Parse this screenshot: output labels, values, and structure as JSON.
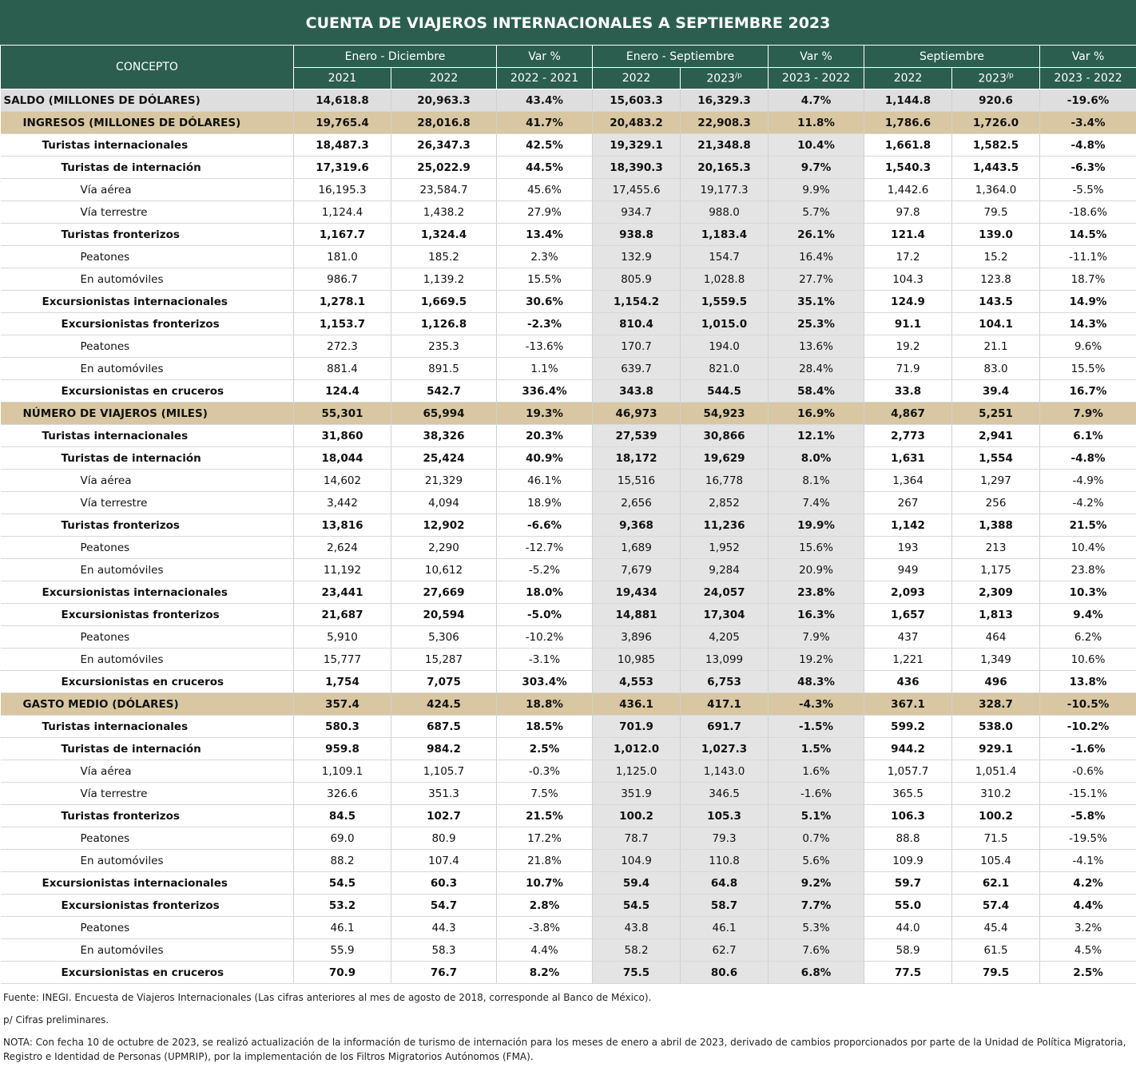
{
  "title": "CUENTA DE VIAJEROS INTERNACIONALES A SEPTIEMBRE 2023",
  "header": {
    "concepto": "CONCEPTO",
    "groups": [
      "Enero - Diciembre",
      "Var %",
      "Enero - Septiembre",
      "Var %",
      "Septiembre",
      "Var %"
    ],
    "sub": [
      "2021",
      "2022",
      "2022 - 2021",
      "2022",
      "2023",
      "2023 - 2022",
      "2022",
      "2023",
      "2023 - 2022"
    ],
    "sup_p": "/p"
  },
  "rows": [
    {
      "label": "SALDO (MILLONES DE DÓLARES)",
      "level": 0,
      "style": "saldo",
      "v": [
        "14,618.8",
        "20,963.3",
        "43.4%",
        "15,603.3",
        "16,329.3",
        "4.7%",
        "1,144.8",
        "920.6",
        "-19.6%"
      ]
    },
    {
      "label": "INGRESOS (MILLONES DE DÓLARES)",
      "level": 1,
      "style": "sec",
      "v": [
        "19,765.4",
        "28,016.8",
        "41.7%",
        "20,483.2",
        "22,908.3",
        "11.8%",
        "1,786.6",
        "1,726.0",
        "-3.4%"
      ]
    },
    {
      "label": "Turistas internacionales",
      "level": 2,
      "style": "b",
      "v": [
        "18,487.3",
        "26,347.3",
        "42.5%",
        "19,329.1",
        "21,348.8",
        "10.4%",
        "1,661.8",
        "1,582.5",
        "-4.8%"
      ]
    },
    {
      "label": "Turistas de internación",
      "level": 3,
      "style": "b",
      "v": [
        "17,319.6",
        "25,022.9",
        "44.5%",
        "18,390.3",
        "20,165.3",
        "9.7%",
        "1,540.3",
        "1,443.5",
        "-6.3%"
      ]
    },
    {
      "label": "Vía aérea",
      "level": 4,
      "style": "n",
      "v": [
        "16,195.3",
        "23,584.7",
        "45.6%",
        "17,455.6",
        "19,177.3",
        "9.9%",
        "1,442.6",
        "1,364.0",
        "-5.5%"
      ]
    },
    {
      "label": "Vía terrestre",
      "level": 4,
      "style": "n",
      "v": [
        "1,124.4",
        "1,438.2",
        "27.9%",
        "934.7",
        "988.0",
        "5.7%",
        "97.8",
        "79.5",
        "-18.6%"
      ]
    },
    {
      "label": "Turistas fronterizos",
      "level": 3,
      "style": "b",
      "v": [
        "1,167.7",
        "1,324.4",
        "13.4%",
        "938.8",
        "1,183.4",
        "26.1%",
        "121.4",
        "139.0",
        "14.5%"
      ]
    },
    {
      "label": "Peatones",
      "level": 4,
      "style": "n",
      "v": [
        "181.0",
        "185.2",
        "2.3%",
        "132.9",
        "154.7",
        "16.4%",
        "17.2",
        "15.2",
        "-11.1%"
      ]
    },
    {
      "label": "En automóviles",
      "level": 4,
      "style": "n",
      "v": [
        "986.7",
        "1,139.2",
        "15.5%",
        "805.9",
        "1,028.8",
        "27.7%",
        "104.3",
        "123.8",
        "18.7%"
      ]
    },
    {
      "label": "Excursionistas internacionales",
      "level": 2,
      "style": "b",
      "v": [
        "1,278.1",
        "1,669.5",
        "30.6%",
        "1,154.2",
        "1,559.5",
        "35.1%",
        "124.9",
        "143.5",
        "14.9%"
      ]
    },
    {
      "label": "Excursionistas fronterizos",
      "level": 3,
      "style": "b",
      "v": [
        "1,153.7",
        "1,126.8",
        "-2.3%",
        "810.4",
        "1,015.0",
        "25.3%",
        "91.1",
        "104.1",
        "14.3%"
      ]
    },
    {
      "label": "Peatones",
      "level": 4,
      "style": "n",
      "v": [
        "272.3",
        "235.3",
        "-13.6%",
        "170.7",
        "194.0",
        "13.6%",
        "19.2",
        "21.1",
        "9.6%"
      ]
    },
    {
      "label": "En automóviles",
      "level": 4,
      "style": "n",
      "v": [
        "881.4",
        "891.5",
        "1.1%",
        "639.7",
        "821.0",
        "28.4%",
        "71.9",
        "83.0",
        "15.5%"
      ]
    },
    {
      "label": "Excursionistas en cruceros",
      "level": 3,
      "style": "b",
      "v": [
        "124.4",
        "542.7",
        "336.4%",
        "343.8",
        "544.5",
        "58.4%",
        "33.8",
        "39.4",
        "16.7%"
      ]
    },
    {
      "label": "NÚMERO DE VIAJEROS (MILES)",
      "level": 1,
      "style": "sec",
      "v": [
        "55,301",
        "65,994",
        "19.3%",
        "46,973",
        "54,923",
        "16.9%",
        "4,867",
        "5,251",
        "7.9%"
      ]
    },
    {
      "label": "Turistas internacionales",
      "level": 2,
      "style": "b",
      "v": [
        "31,860",
        "38,326",
        "20.3%",
        "27,539",
        "30,866",
        "12.1%",
        "2,773",
        "2,941",
        "6.1%"
      ]
    },
    {
      "label": "Turistas de internación",
      "level": 3,
      "style": "b",
      "v": [
        "18,044",
        "25,424",
        "40.9%",
        "18,172",
        "19,629",
        "8.0%",
        "1,631",
        "1,554",
        "-4.8%"
      ]
    },
    {
      "label": "Vía aérea",
      "level": 4,
      "style": "n",
      "v": [
        "14,602",
        "21,329",
        "46.1%",
        "15,516",
        "16,778",
        "8.1%",
        "1,364",
        "1,297",
        "-4.9%"
      ]
    },
    {
      "label": "Vía terrestre",
      "level": 4,
      "style": "n",
      "v": [
        "3,442",
        "4,094",
        "18.9%",
        "2,656",
        "2,852",
        "7.4%",
        "267",
        "256",
        "-4.2%"
      ]
    },
    {
      "label": "Turistas fronterizos",
      "level": 3,
      "style": "b",
      "v": [
        "13,816",
        "12,902",
        "-6.6%",
        "9,368",
        "11,236",
        "19.9%",
        "1,142",
        "1,388",
        "21.5%"
      ]
    },
    {
      "label": "Peatones",
      "level": 4,
      "style": "n",
      "v": [
        "2,624",
        "2,290",
        "-12.7%",
        "1,689",
        "1,952",
        "15.6%",
        "193",
        "213",
        "10.4%"
      ]
    },
    {
      "label": "En automóviles",
      "level": 4,
      "style": "n",
      "v": [
        "11,192",
        "10,612",
        "-5.2%",
        "7,679",
        "9,284",
        "20.9%",
        "949",
        "1,175",
        "23.8%"
      ]
    },
    {
      "label": "Excursionistas internacionales",
      "level": 2,
      "style": "b",
      "v": [
        "23,441",
        "27,669",
        "18.0%",
        "19,434",
        "24,057",
        "23.8%",
        "2,093",
        "2,309",
        "10.3%"
      ]
    },
    {
      "label": "Excursionistas fronterizos",
      "level": 3,
      "style": "b",
      "v": [
        "21,687",
        "20,594",
        "-5.0%",
        "14,881",
        "17,304",
        "16.3%",
        "1,657",
        "1,813",
        "9.4%"
      ]
    },
    {
      "label": "Peatones",
      "level": 4,
      "style": "n",
      "v": [
        "5,910",
        "5,306",
        "-10.2%",
        "3,896",
        "4,205",
        "7.9%",
        "437",
        "464",
        "6.2%"
      ]
    },
    {
      "label": "En automóviles",
      "level": 4,
      "style": "n",
      "v": [
        "15,777",
        "15,287",
        "-3.1%",
        "10,985",
        "13,099",
        "19.2%",
        "1,221",
        "1,349",
        "10.6%"
      ]
    },
    {
      "label": "Excursionistas en cruceros",
      "level": 3,
      "style": "b",
      "v": [
        "1,754",
        "7,075",
        "303.4%",
        "4,553",
        "6,753",
        "48.3%",
        "436",
        "496",
        "13.8%"
      ]
    },
    {
      "label": "GASTO MEDIO (DÓLARES)",
      "level": 1,
      "style": "sec",
      "v": [
        "357.4",
        "424.5",
        "18.8%",
        "436.1",
        "417.1",
        "-4.3%",
        "367.1",
        "328.7",
        "-10.5%"
      ]
    },
    {
      "label": "Turistas internacionales",
      "level": 2,
      "style": "b",
      "v": [
        "580.3",
        "687.5",
        "18.5%",
        "701.9",
        "691.7",
        "-1.5%",
        "599.2",
        "538.0",
        "-10.2%"
      ]
    },
    {
      "label": "Turistas de internación",
      "level": 3,
      "style": "b",
      "v": [
        "959.8",
        "984.2",
        "2.5%",
        "1,012.0",
        "1,027.3",
        "1.5%",
        "944.2",
        "929.1",
        "-1.6%"
      ]
    },
    {
      "label": "Vía aérea",
      "level": 4,
      "style": "n",
      "v": [
        "1,109.1",
        "1,105.7",
        "-0.3%",
        "1,125.0",
        "1,143.0",
        "1.6%",
        "1,057.7",
        "1,051.4",
        "-0.6%"
      ]
    },
    {
      "label": "Vía terrestre",
      "level": 4,
      "style": "n",
      "v": [
        "326.6",
        "351.3",
        "7.5%",
        "351.9",
        "346.5",
        "-1.6%",
        "365.5",
        "310.2",
        "-15.1%"
      ]
    },
    {
      "label": "Turistas fronterizos",
      "level": 3,
      "style": "b",
      "v": [
        "84.5",
        "102.7",
        "21.5%",
        "100.2",
        "105.3",
        "5.1%",
        "106.3",
        "100.2",
        "-5.8%"
      ]
    },
    {
      "label": "Peatones",
      "level": 4,
      "style": "n",
      "v": [
        "69.0",
        "80.9",
        "17.2%",
        "78.7",
        "79.3",
        "0.7%",
        "88.8",
        "71.5",
        "-19.5%"
      ]
    },
    {
      "label": "En automóviles",
      "level": 4,
      "style": "n",
      "v": [
        "88.2",
        "107.4",
        "21.8%",
        "104.9",
        "110.8",
        "5.6%",
        "109.9",
        "105.4",
        "-4.1%"
      ]
    },
    {
      "label": "Excursionistas internacionales",
      "level": 2,
      "style": "b",
      "v": [
        "54.5",
        "60.3",
        "10.7%",
        "59.4",
        "64.8",
        "9.2%",
        "59.7",
        "62.1",
        "4.2%"
      ]
    },
    {
      "label": "Excursionistas fronterizos",
      "level": 3,
      "style": "b",
      "v": [
        "53.2",
        "54.7",
        "2.8%",
        "54.5",
        "58.7",
        "7.7%",
        "55.0",
        "57.4",
        "4.4%"
      ]
    },
    {
      "label": "Peatones",
      "level": 4,
      "style": "n",
      "v": [
        "46.1",
        "44.3",
        "-3.8%",
        "43.8",
        "46.1",
        "5.3%",
        "44.0",
        "45.4",
        "3.2%"
      ]
    },
    {
      "label": "En automóviles",
      "level": 4,
      "style": "n",
      "v": [
        "55.9",
        "58.3",
        "4.4%",
        "58.2",
        "62.7",
        "7.6%",
        "58.9",
        "61.5",
        "4.5%"
      ]
    },
    {
      "label": "Excursionistas en cruceros",
      "level": 3,
      "style": "b",
      "v": [
        "70.9",
        "76.7",
        "8.2%",
        "75.5",
        "80.6",
        "6.8%",
        "77.5",
        "79.5",
        "2.5%"
      ]
    }
  ],
  "notes": {
    "fuente": "Fuente: INEGI. Encuesta de Viajeros Internacionales (Las cifras anteriores al mes de agosto de 2018, corresponde al Banco de México).",
    "prelim": "p/ Cifras preliminares.",
    "nota": "NOTA: Con fecha 10 de octubre de 2023, se realizó actualización de la información de turismo de internación para los meses de enero a abril de 2023, derivado de cambios proporcionados por parte de la Unidad de Política Migratoria, Registro e Identidad de Personas (UPMRIP), por la implementación de los Filtros Migratorios Autónomos (FMA)."
  },
  "colors": {
    "header_green": "#2b5e4e",
    "section_tan": "#d8c7a2",
    "saldo_gray": "#dedede",
    "shade_gray": "#e4e4e4"
  }
}
